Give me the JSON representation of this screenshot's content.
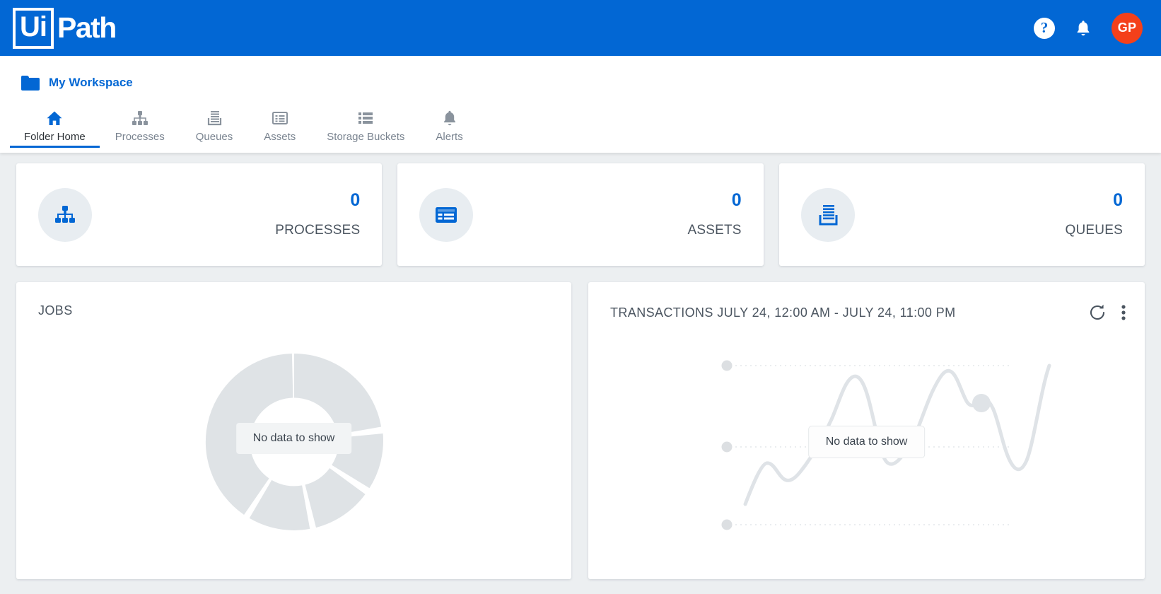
{
  "topbar": {
    "logo_ui": "Ui",
    "logo_path": "Path",
    "help_label": "?",
    "help_icon": "help-circle-icon",
    "bell_icon": "bell-icon",
    "avatar_initials": "GP",
    "avatar_color": "#f4401a",
    "background_color": "#0267d4"
  },
  "header": {
    "workspace_icon": "folder-icon",
    "workspace_name": "My Workspace",
    "tabs": [
      {
        "label": "Folder Home",
        "icon": "home-icon",
        "active": true
      },
      {
        "label": "Processes",
        "icon": "org-chart-icon",
        "active": false
      },
      {
        "label": "Queues",
        "icon": "queue-stack-icon",
        "active": false
      },
      {
        "label": "Assets",
        "icon": "asset-list-icon",
        "active": false
      },
      {
        "label": "Storage Buckets",
        "icon": "storage-rows-icon",
        "active": false
      },
      {
        "label": "Alerts",
        "icon": "bell-icon",
        "active": false
      }
    ],
    "active_tab_underline_color": "#0267d4"
  },
  "stats": [
    {
      "value": "0",
      "label": "PROCESSES",
      "icon": "org-chart-icon"
    },
    {
      "value": "0",
      "label": "ASSETS",
      "icon": "asset-list-icon"
    },
    {
      "value": "0",
      "label": "QUEUES",
      "icon": "queue-stack-icon"
    }
  ],
  "panels": {
    "jobs": {
      "title": "JOBS",
      "empty_message": "No data to show"
    },
    "transactions": {
      "title": "TRANSACTIONS JULY 24, 12:00 AM - JULY 24, 11:00 PM",
      "empty_message": "No data to show",
      "refresh_icon": "refresh-icon",
      "more_icon": "kebab-menu-icon"
    }
  },
  "chart_data": [
    {
      "type": "pie",
      "title": "JOBS",
      "categories": [],
      "values": [],
      "empty": true,
      "empty_message": "No data to show",
      "note": "Placeholder donut chart, no data rendered"
    },
    {
      "type": "line",
      "title": "TRANSACTIONS JULY 24, 12:00 AM - JULY 24, 11:00 PM",
      "x": [],
      "series": [],
      "empty": true,
      "empty_message": "No data to show",
      "grid": true,
      "gridlines": 3,
      "note": "Placeholder line chart, no data rendered"
    }
  ]
}
